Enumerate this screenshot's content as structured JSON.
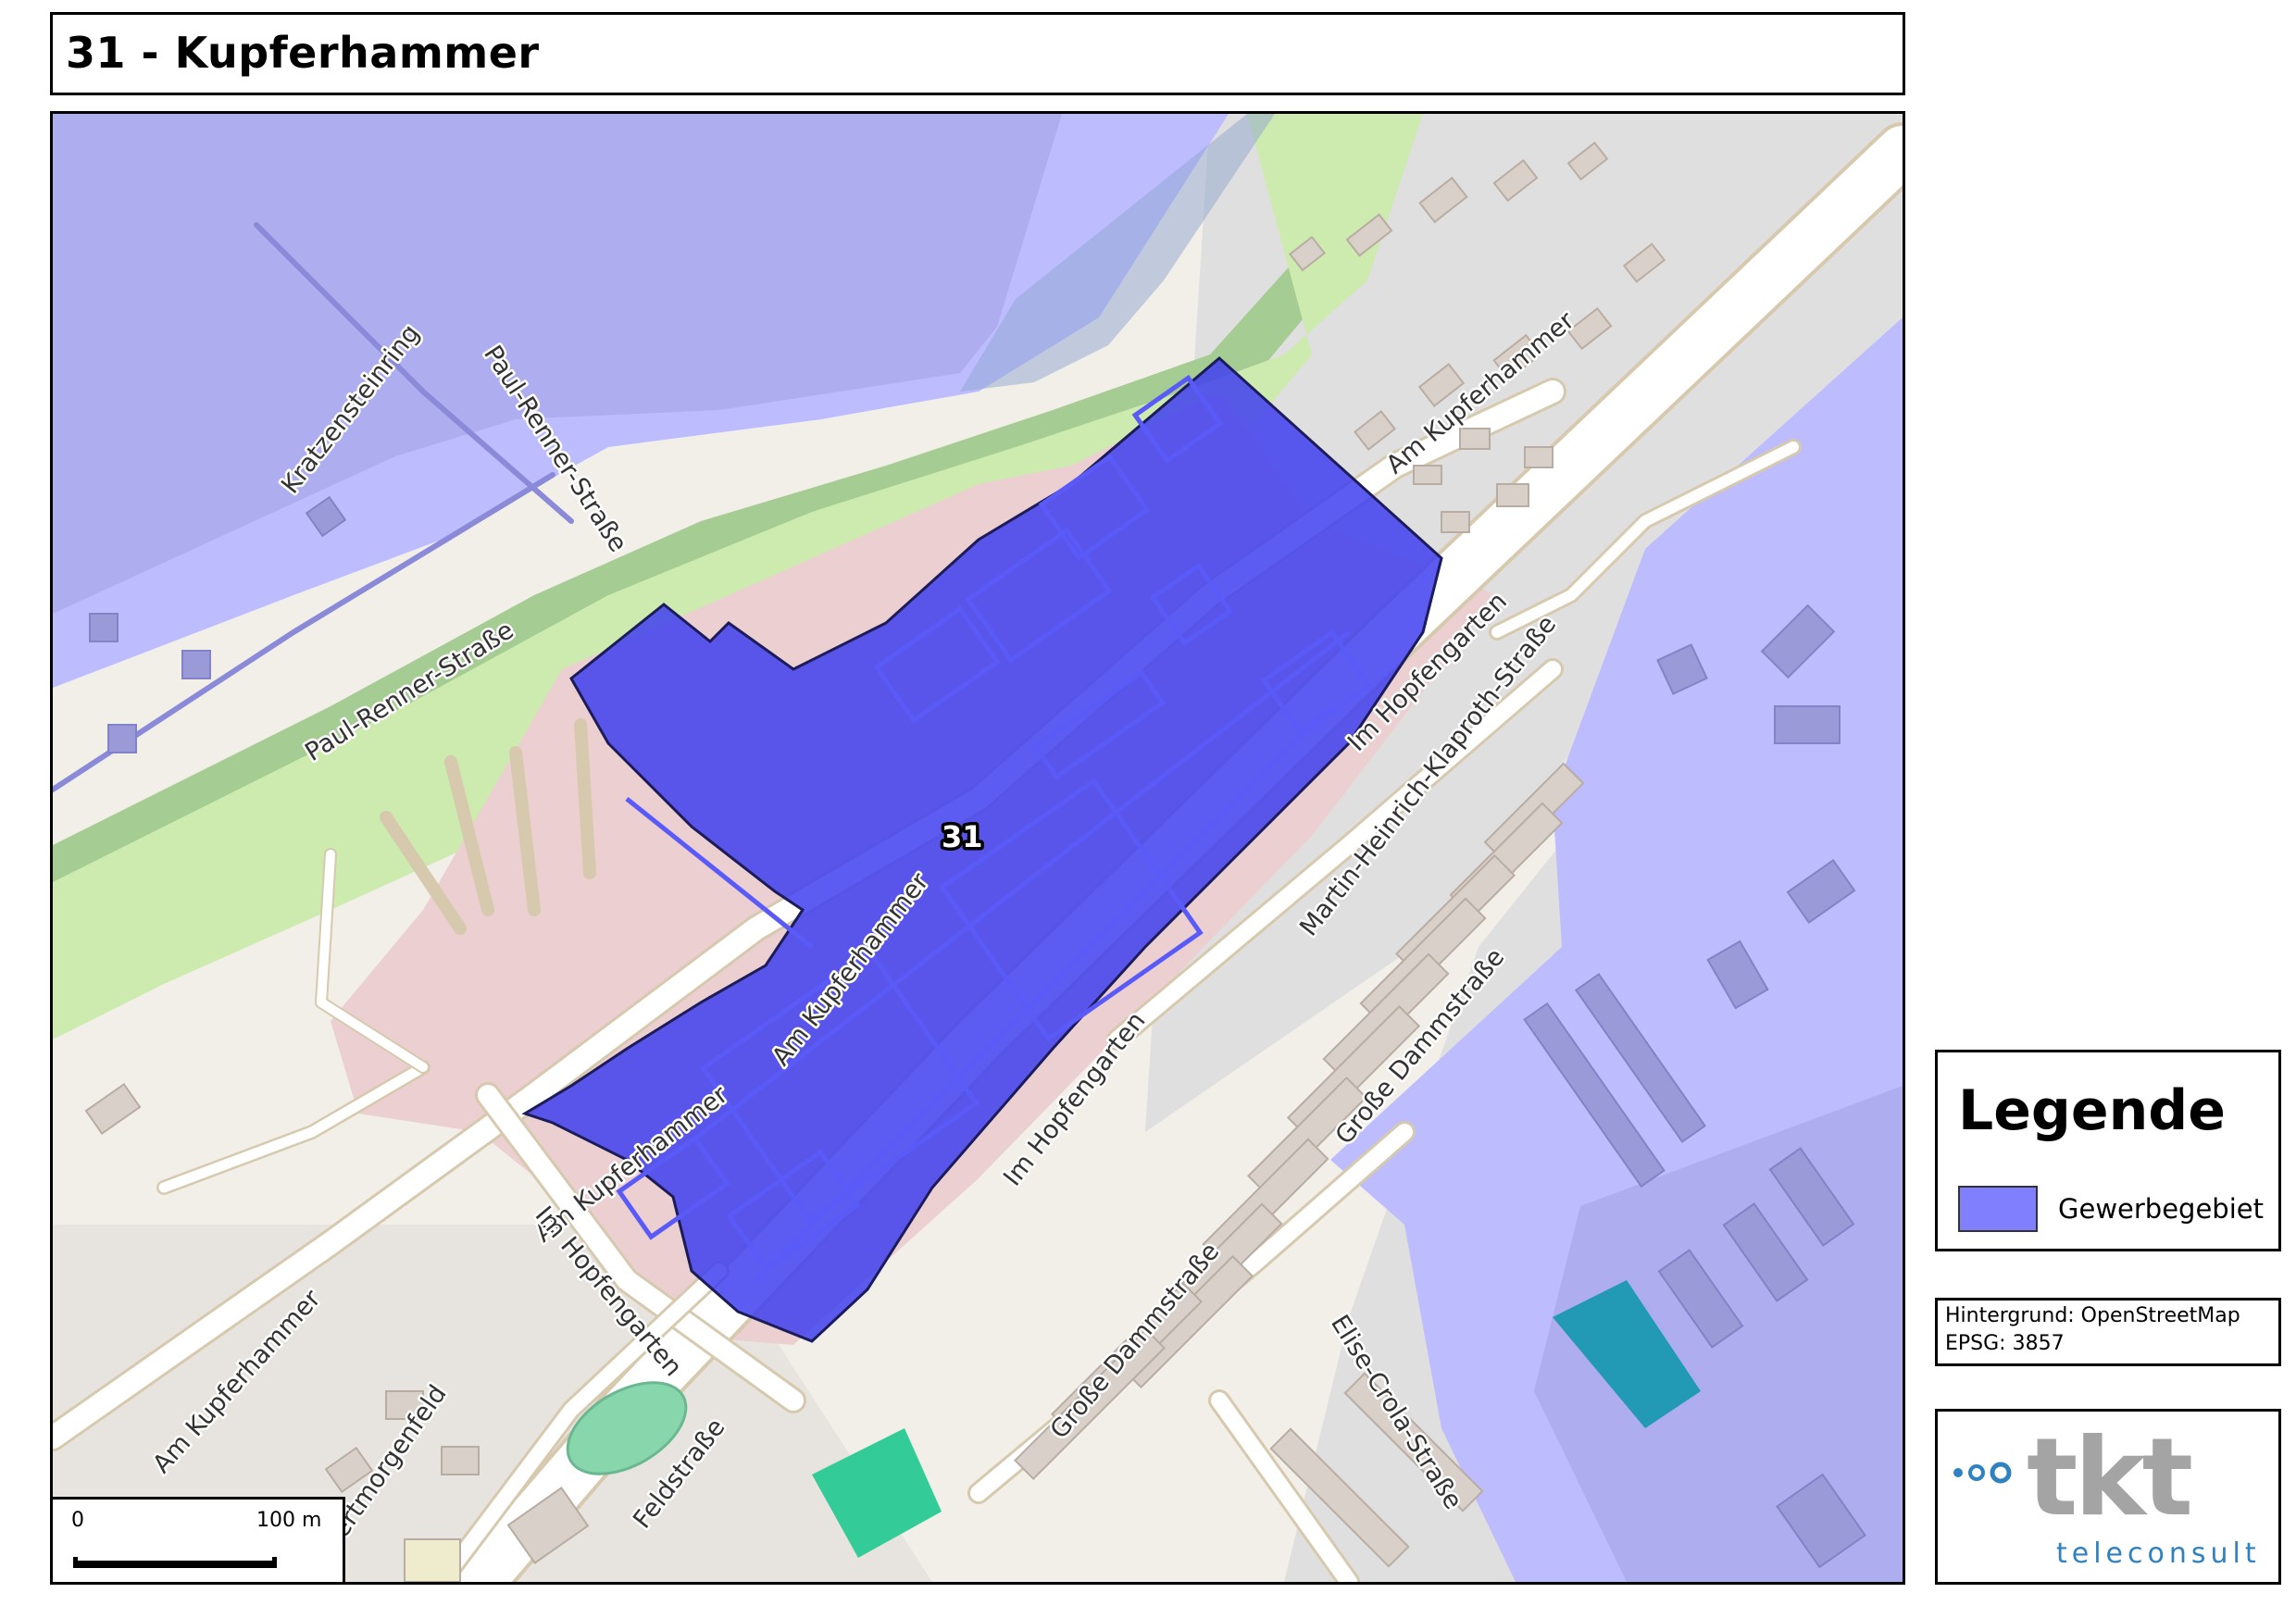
{
  "title": "31 - Kupferhammer",
  "map": {
    "zone_label": "31",
    "street_labels": {
      "kratzensteinring": "Kratzensteinring",
      "paul_renner_1": "Paul-Renner-Straße",
      "paul_renner_2": "Paul-Renner-Straße",
      "am_kupferhammer_1": "Am Kupferhammer",
      "am_kupferhammer_2": "Am Kupferhammer",
      "am_kupferhammer_3": "Am Kupferhammer",
      "am_kupferhammer_4": "Am Kupferhammer",
      "im_hopfengarten_1": "Im Hopfengarten",
      "im_hopfengarten_2": "Im Hopfengarten",
      "im_hopfengarten_3": "Im Hopfengarten",
      "martin_heinrich": "Martin-Heinrich-Klaproth-Straße",
      "grosse_damm_1": "Große Dammstraße",
      "grosse_damm_2": "Große Dammstraße",
      "elise_crola": "Elise-Crola-Straße",
      "feldstrasse": "Feldstraße",
      "morgenfeld": "ertmorgenfeld"
    }
  },
  "scale": {
    "zero": "0",
    "hundred": "100 m"
  },
  "legend": {
    "title": "Legende",
    "items": [
      {
        "label": "Gewerbegebiet",
        "color": "#8080ff"
      }
    ]
  },
  "source": {
    "background": "Hintergrund: OpenStreetMap",
    "epsg": "EPSG: 3857"
  },
  "logo": {
    "word": "tkt",
    "sub": "teleconsult"
  },
  "colors": {
    "zone_fill": "#3f3ff0",
    "commercial_fill": "#bcbcff",
    "green": "#a5cc92",
    "light_green": "#cdeaaf",
    "road": "#ffffff",
    "road_casing": "#d6c9ae",
    "building": "#d9d0c9",
    "residential": "#e0dfdf",
    "industrial": "#eccfd1"
  }
}
